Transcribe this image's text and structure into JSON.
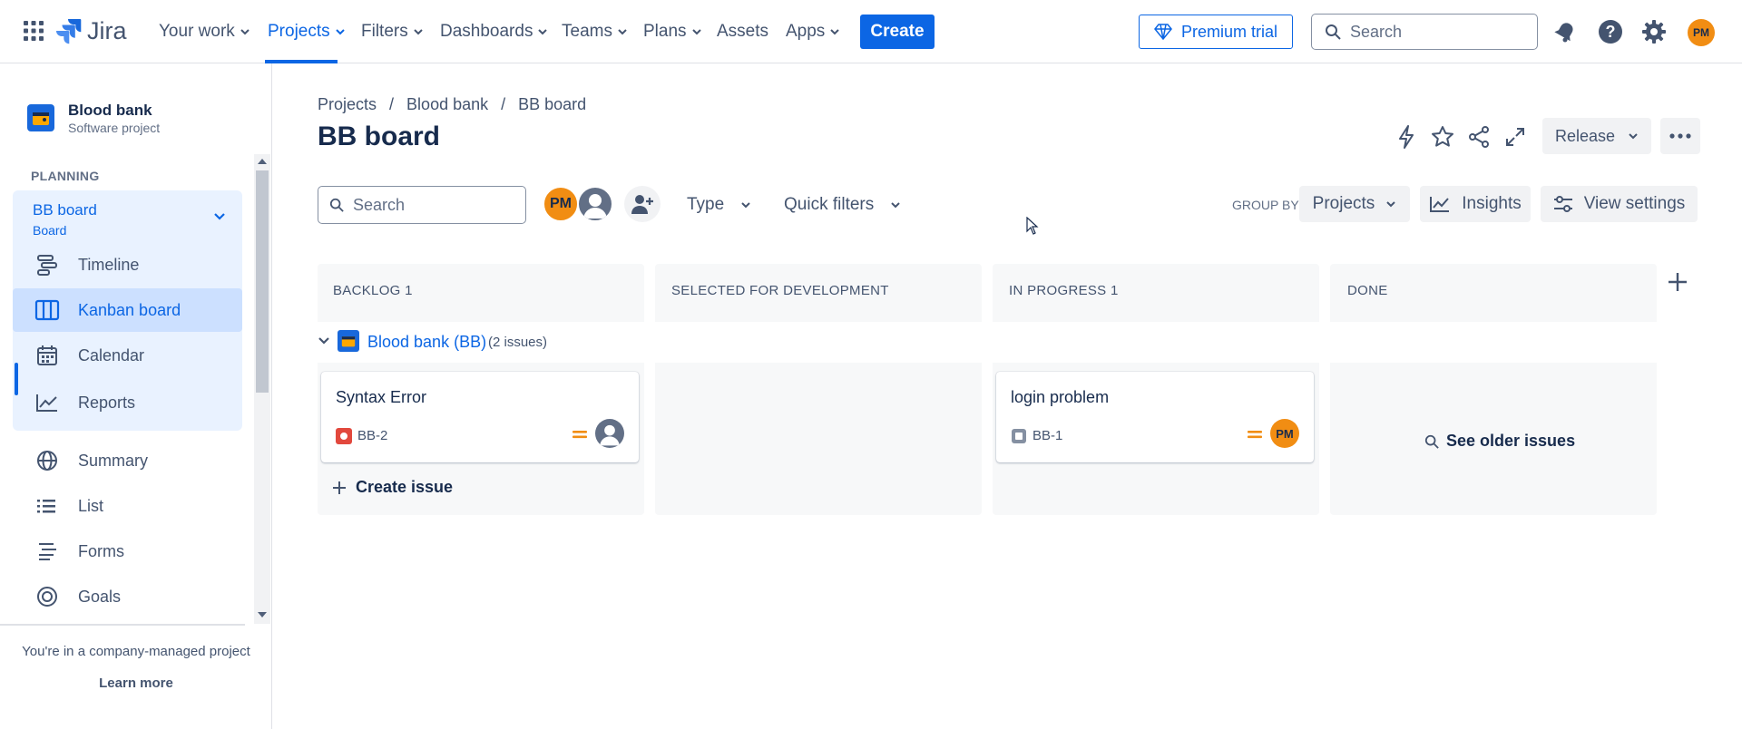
{
  "colors": {
    "primary": "#0c66e4",
    "avatar_orange": "#f18d13",
    "sidebar_active": "#cce0ff",
    "sidebar_group": "#e9f2ff",
    "bug_red": "#e2483d",
    "priority_orange": "#f18d13"
  },
  "topnav": {
    "product": "Jira",
    "items": [
      {
        "label": "Your work",
        "icon": "chevron-down-icon"
      },
      {
        "label": "Projects",
        "icon": "chevron-down-icon"
      },
      {
        "label": "Filters",
        "icon": "chevron-down-icon"
      },
      {
        "label": "Dashboards",
        "icon": "chevron-down-icon"
      },
      {
        "label": "Teams",
        "icon": "chevron-down-icon"
      },
      {
        "label": "Plans",
        "icon": "chevron-down-icon"
      },
      {
        "label": "Assets"
      },
      {
        "label": "Apps",
        "icon": "chevron-down-icon"
      }
    ],
    "create_label": "Create",
    "premium_label": "Premium trial",
    "search_placeholder": "Search",
    "user_initials": "PM"
  },
  "sidebar": {
    "project_name": "Blood bank",
    "project_type": "Software project",
    "planning_label": "PLANNING",
    "board": {
      "title": "BB board",
      "subtitle": "Board"
    },
    "planning_items": [
      {
        "label": "Timeline",
        "icon": "timeline-icon"
      },
      {
        "label": "Kanban board",
        "icon": "board-icon",
        "active": true
      },
      {
        "label": "Calendar",
        "icon": "calendar-icon"
      },
      {
        "label": "Reports",
        "icon": "reports-icon"
      }
    ],
    "other_items": [
      {
        "label": "Summary",
        "icon": "globe-icon"
      },
      {
        "label": "List",
        "icon": "list-icon"
      },
      {
        "label": "Forms",
        "icon": "forms-icon"
      },
      {
        "label": "Goals",
        "icon": "goals-icon"
      }
    ],
    "footer_text": "You're in a company-managed project",
    "learn_more": "Learn more"
  },
  "main": {
    "breadcrumb": [
      "Projects",
      "/",
      "Blood bank",
      "/",
      "BB board"
    ],
    "title": "BB board",
    "release_label": "Release",
    "search_placeholder": "Search",
    "assignee_initials": "PM",
    "filters": {
      "type": "Type",
      "quick": "Quick filters"
    },
    "group_by_label": "GROUP BY",
    "group_by_value": "Projects",
    "insights_label": "Insights",
    "view_settings_label": "View settings"
  },
  "board": {
    "columns": [
      {
        "title": "BACKLOG 1"
      },
      {
        "title": "SELECTED FOR DEVELOPMENT"
      },
      {
        "title": "IN PROGRESS 1"
      },
      {
        "title": "DONE"
      }
    ],
    "swimlane": {
      "name": "Blood bank (BB)",
      "count": "(2 issues)"
    },
    "cards": [
      {
        "title": "Syntax Error",
        "key": "BB-2",
        "type": "bug",
        "priority": "medium",
        "assignee": "unassigned"
      },
      {
        "title": "login problem",
        "key": "BB-1",
        "type": "task",
        "priority": "medium",
        "assignee": "PM"
      }
    ],
    "create_issue": "Create issue",
    "see_older": "See older issues"
  }
}
